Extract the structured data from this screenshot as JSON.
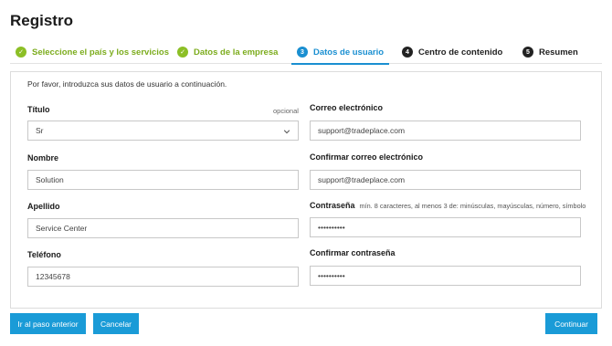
{
  "page": {
    "title": "Registro"
  },
  "steps": [
    {
      "number": "✓",
      "label": "Seleccione el país y los servicios",
      "state": "done"
    },
    {
      "number": "✓",
      "label": "Datos de la empresa",
      "state": "done"
    },
    {
      "number": "3",
      "label": "Datos de usuario",
      "state": "active"
    },
    {
      "number": "4",
      "label": "Centro de contenido",
      "state": "todo"
    },
    {
      "number": "5",
      "label": "Resumen",
      "state": "todo"
    }
  ],
  "form": {
    "intro": "Por favor, introduzca sus datos de usuario a continuación.",
    "title_field": {
      "label": "Título",
      "optional": "opcional",
      "value": "Sr"
    },
    "first_name": {
      "label": "Nombre",
      "value": "Solution"
    },
    "last_name": {
      "label": "Apellido",
      "value": "Service Center"
    },
    "phone": {
      "label": "Teléfono",
      "value": "12345678"
    },
    "email": {
      "label": "Correo electrónico",
      "value": "support@tradeplace.com"
    },
    "email_confirm": {
      "label": "Confirmar correo electrónico",
      "value": "support@tradeplace.com"
    },
    "password": {
      "label": "Contraseña",
      "hint": "mín. 8 caracteres, al menos 3 de: minúsculas, mayúsculas, número, símbolo",
      "value": "••••••••••"
    },
    "password_confirm": {
      "label": "Confirmar contraseña",
      "value": "••••••••••"
    }
  },
  "buttons": {
    "previous": "Ir al paso anterior",
    "cancel": "Cancelar",
    "continue": "Continuar"
  },
  "colors": {
    "accent": "#1a9bd7",
    "done": "#8cbf26"
  }
}
